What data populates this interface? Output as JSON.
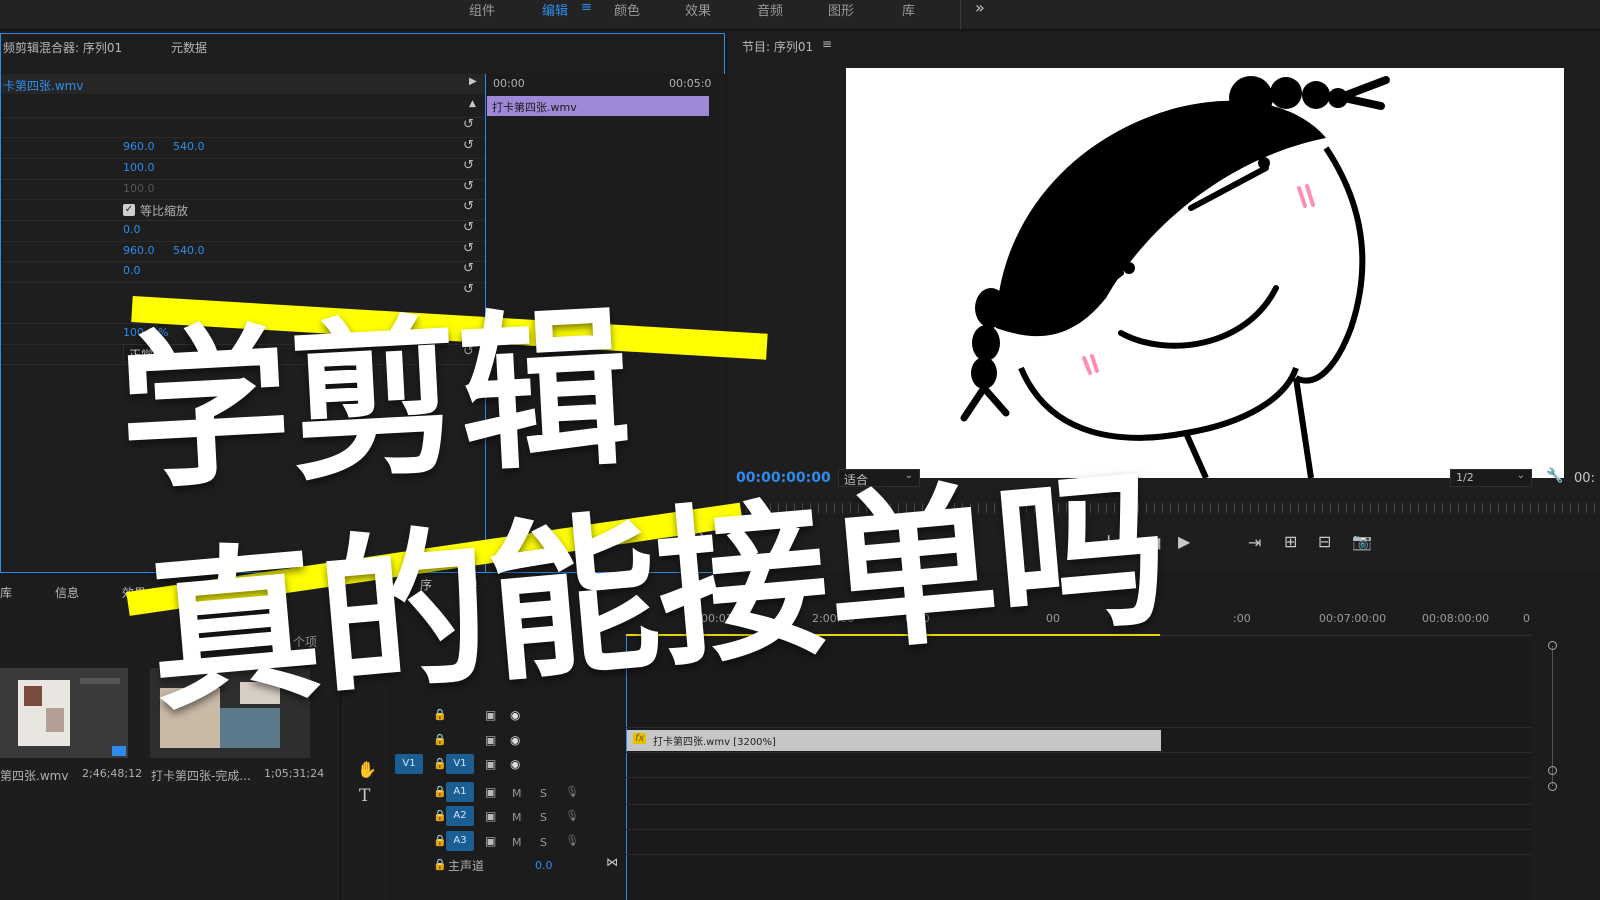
{
  "workspace_tabs": {
    "assembly": "组件",
    "editing": "编辑",
    "editing_menu": "≡",
    "color": "颜色",
    "effects": "效果",
    "audio": "音频",
    "graphics": "图形",
    "libraries": "库",
    "more": "»"
  },
  "effect_controls": {
    "tab_mixer": "频剪辑混合器: 序列01",
    "tab_metadata": "元数据",
    "clip_name": "卡第四张.wmv",
    "time_start": "00:00",
    "time_end": "00:05:0",
    "clip_bar_label": "打卡第四张.wmv",
    "position_x": "960.0",
    "position_y": "540.0",
    "scale": "100.0",
    "scale_width": "100.0",
    "uniform_scale_label": "等比缩放",
    "rotation": "0.0",
    "anchor_x": "960.0",
    "anchor_y": "540.0",
    "flicker": "0.0",
    "opacity": "100.0 %",
    "blend_mode": "正常"
  },
  "program_monitor": {
    "title": "节目: 序列01",
    "menu": "≡",
    "timecode": "00:00:00:00",
    "fit_label": "适合",
    "resolution": "1/2",
    "end_timecode": "00:"
  },
  "project_panel": {
    "tab_library": "库",
    "tab_info": "信息",
    "tab_effects": "效果",
    "items_count": "个项",
    "item1_name": "第四张.wmv",
    "item1_duration": "2;46;48;12",
    "item2_name": "打卡第四张-完成...",
    "item2_duration": "1;05;31;24"
  },
  "timeline": {
    "tab_label": "序",
    "ruler": [
      "00:01:0",
      "2:00:00",
      "00:0",
      "00",
      "0:0",
      ":00",
      "00:07:00:00",
      "00:08:00:00",
      "0"
    ],
    "clip_label": "打卡第四张.wmv [3200%]",
    "fx_badge": "fx",
    "v1_source": "V1",
    "v1": "V1",
    "a1": "A1",
    "a2": "A2",
    "a3": "A3",
    "mute": "M",
    "solo": "S",
    "master_label": "主声道",
    "master_value": "0.0"
  },
  "overlay": {
    "line1": "学剪辑",
    "line2": "真的能接单吗",
    "highlight_color": "#ffff00"
  }
}
